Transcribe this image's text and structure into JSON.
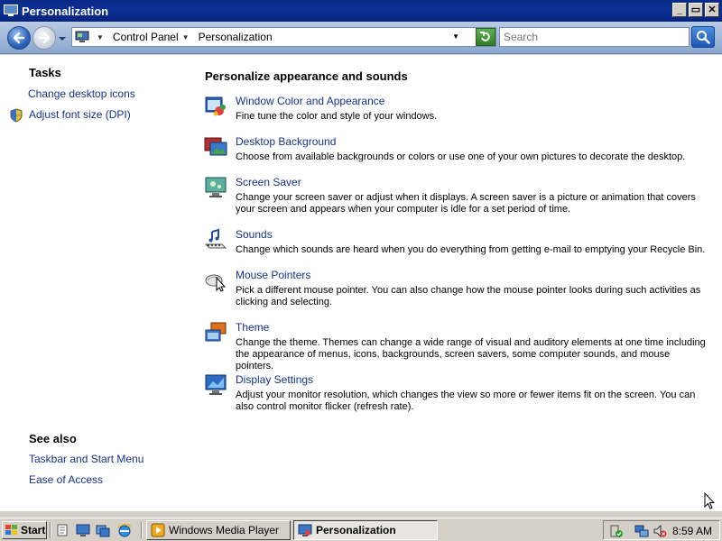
{
  "window": {
    "title": "Personalization",
    "buttons": {
      "minimize": "_",
      "maximize": "▭",
      "close": "✕"
    }
  },
  "addressbar": {
    "breadcrumbs": [
      "Control Panel",
      "Personalization"
    ],
    "search_placeholder": "Search"
  },
  "sidebar": {
    "tasks_title": "Tasks",
    "tasks": [
      {
        "label": "Change desktop icons",
        "icon": "none"
      },
      {
        "label": "Adjust font size (DPI)",
        "icon": "shield-icon"
      }
    ],
    "see_also_title": "See also",
    "see_also": [
      {
        "label": "Taskbar and Start Menu"
      },
      {
        "label": "Ease of Access"
      }
    ]
  },
  "main": {
    "title": "Personalize appearance and sounds",
    "items": [
      {
        "label": "Window Color and Appearance",
        "description": "Fine tune the color and style of your windows.",
        "icon": "window-color-icon"
      },
      {
        "label": "Desktop Background",
        "description": "Choose from available backgrounds or colors or use one of your own pictures to decorate the desktop.",
        "icon": "desktop-background-icon"
      },
      {
        "label": "Screen Saver",
        "description": "Change your screen saver or adjust when it displays. A screen saver is a picture or animation that covers your screen and appears when your computer is idle for a set period of time.",
        "icon": "screen-saver-icon"
      },
      {
        "label": "Sounds",
        "description": "Change which sounds are heard when you do everything from getting e-mail to emptying your Recycle Bin.",
        "icon": "sounds-icon"
      },
      {
        "label": "Mouse Pointers",
        "description": "Pick a different mouse pointer. You can also change how the mouse pointer looks during such activities as clicking and selecting.",
        "icon": "mouse-pointer-icon"
      },
      {
        "label": "Theme",
        "description": "Change the theme. Themes can change a wide range of visual and auditory elements at one time including the appearance of menus, icons, backgrounds, screen savers, some computer sounds, and mouse pointers.",
        "icon": "theme-icon"
      },
      {
        "label": "Display Settings",
        "description": "Adjust your monitor resolution, which changes the view so more or fewer items fit on the screen. You can also control monitor flicker (refresh rate).",
        "icon": "display-settings-icon"
      }
    ]
  },
  "taskbar": {
    "start_label": "Start",
    "tasks": [
      {
        "label": "Windows Media Player",
        "active": false,
        "icon": "media-player-icon"
      },
      {
        "label": "Personalization",
        "active": true,
        "icon": "personalization-icon"
      }
    ],
    "clock": "8:59 AM"
  },
  "colors": {
    "link": "#15318a",
    "titlebar": "#0a2a86",
    "addressbar": "#8aa7cf"
  }
}
